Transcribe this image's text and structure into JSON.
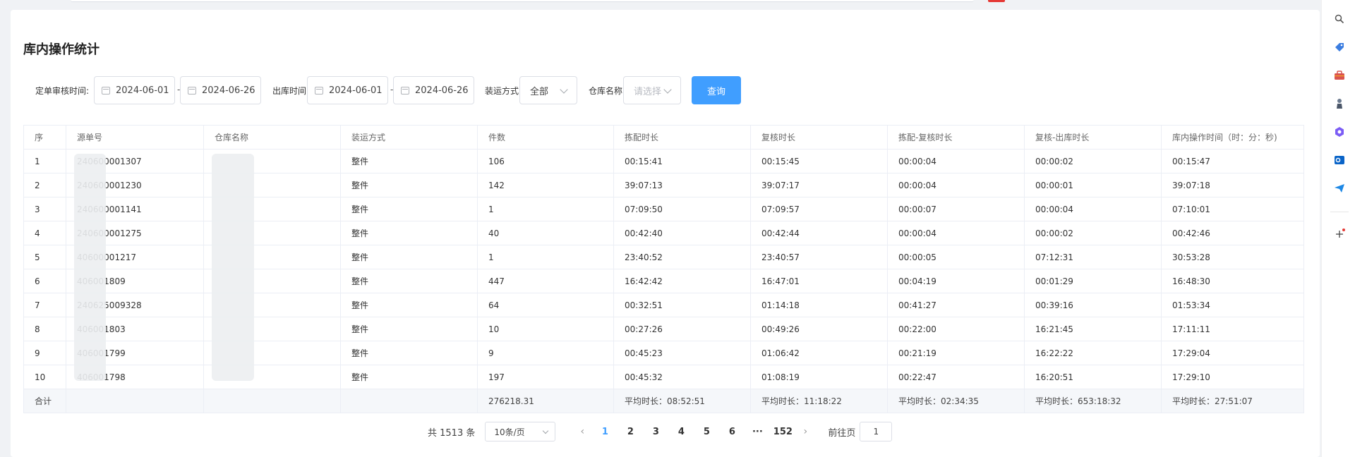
{
  "page": {
    "title": "库内操作统计"
  },
  "filters": {
    "audit_time_label": "定单审核时间:",
    "audit_start": "2024-06-01",
    "audit_end": "2024-06-26",
    "range_dash": "-",
    "outbound_time_label": "出库时间:",
    "outbound_start": "2024-06-01",
    "outbound_end": "2024-06-26",
    "shipping_label": "装运方式:",
    "shipping_value": "全部",
    "warehouse_label": "仓库名称:",
    "warehouse_placeholder": "请选择",
    "query_button": "查询"
  },
  "table": {
    "headers": [
      "序",
      "源单号",
      "仓库名称",
      "装运方式",
      "件数",
      "拣配时长",
      "复核时长",
      "拣配-复核时长",
      "复核-出库时长",
      "库内操作时间（时：分：秒)"
    ],
    "rows": [
      {
        "idx": "1",
        "order": "240600001307",
        "warehouse": "",
        "ship": "整件",
        "qty": "106",
        "pick": "00:15:41",
        "review": "00:15:45",
        "pick_review": "00:00:04",
        "review_out": "00:00:02",
        "total": "00:15:47"
      },
      {
        "idx": "2",
        "order": "240600001230",
        "warehouse": "",
        "ship": "整件",
        "qty": "142",
        "pick": "39:07:13",
        "review": "39:07:17",
        "pick_review": "00:00:04",
        "review_out": "00:00:01",
        "total": "39:07:18"
      },
      {
        "idx": "3",
        "order": "240600001141",
        "warehouse": "",
        "ship": "整件",
        "qty": "1",
        "pick": "07:09:50",
        "review": "07:09:57",
        "pick_review": "00:00:07",
        "review_out": "00:00:04",
        "total": "07:10:01"
      },
      {
        "idx": "4",
        "order": "240600001275",
        "warehouse": "",
        "ship": "整件",
        "qty": "40",
        "pick": "00:42:40",
        "review": "00:42:44",
        "pick_review": "00:00:04",
        "review_out": "00:00:02",
        "total": "00:42:46"
      },
      {
        "idx": "5",
        "order": "40600001217",
        "warehouse": "",
        "ship": "整件",
        "qty": "1",
        "pick": "23:40:52",
        "review": "23:40:57",
        "pick_review": "00:00:05",
        "review_out": "07:12:31",
        "total": "30:53:28"
      },
      {
        "idx": "6",
        "order": "406001809",
        "warehouse": "",
        "ship": "整件",
        "qty": "447",
        "pick": "16:42:42",
        "review": "16:47:01",
        "pick_review": "00:04:19",
        "review_out": "00:01:29",
        "total": "16:48:30"
      },
      {
        "idx": "7",
        "order": "240625009328",
        "warehouse": "",
        "ship": "整件",
        "qty": "64",
        "pick": "00:32:51",
        "review": "01:14:18",
        "pick_review": "00:41:27",
        "review_out": "00:39:16",
        "total": "01:53:34"
      },
      {
        "idx": "8",
        "order": "406001803",
        "warehouse": "",
        "ship": "整件",
        "qty": "10",
        "pick": "00:27:26",
        "review": "00:49:26",
        "pick_review": "00:22:00",
        "review_out": "16:21:45",
        "total": "17:11:11"
      },
      {
        "idx": "9",
        "order": "406001799",
        "warehouse": "",
        "ship": "整件",
        "qty": "9",
        "pick": "00:45:23",
        "review": "01:06:42",
        "pick_review": "00:21:19",
        "review_out": "16:22:22",
        "total": "17:29:04"
      },
      {
        "idx": "10",
        "order": "406001798",
        "warehouse": "",
        "ship": "整件",
        "qty": "197",
        "pick": "00:45:32",
        "review": "01:08:19",
        "pick_review": "00:22:47",
        "review_out": "16:20:51",
        "total": "17:29:10"
      }
    ],
    "summary": {
      "label": "合计",
      "qty": "276218.31",
      "pick": "平均时长：08:52:51",
      "review": "平均时长：11:18:22",
      "pick_review": "平均时长：02:34:35",
      "review_out": "平均时长：653:18:32",
      "total": "平均时长：27:51:07"
    }
  },
  "pagination": {
    "total": "共 1513 条",
    "page_size": "10条/页",
    "pages": [
      "1",
      "2",
      "3",
      "4",
      "5",
      "6"
    ],
    "ellipsis": "···",
    "last_page": "152",
    "prev_icon": "‹",
    "next_icon": "›",
    "goto_label": "前往页",
    "goto_value": "1",
    "active_page": "1"
  },
  "sidebar": {
    "icons": [
      "search-icon",
      "tag-icon",
      "toolbox-icon",
      "chess-icon",
      "copilot-icon",
      "outlook-icon",
      "send-icon",
      "add-icon"
    ]
  },
  "colors": {
    "primary": "#409eff",
    "border": "#ebeef5",
    "summary_bg": "#f5f7fa"
  }
}
